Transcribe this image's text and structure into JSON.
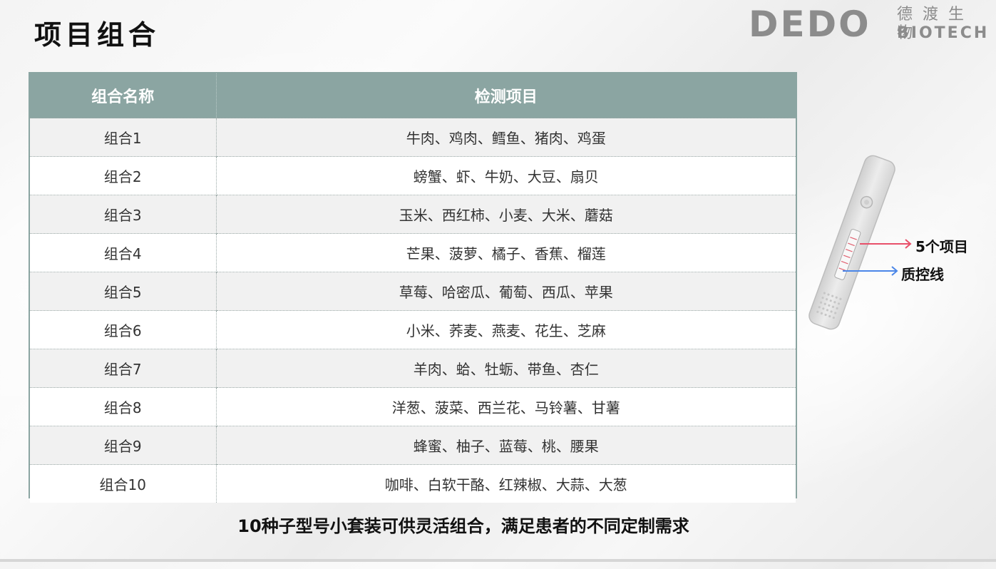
{
  "page": {
    "title": "项目组合"
  },
  "logo": {
    "brand": "DEDO",
    "name_cn": "德渡生物",
    "name_en": "BIOTECH"
  },
  "table": {
    "headers": [
      "组合名称",
      "检测项目"
    ],
    "rows": [
      {
        "name": "组合1",
        "items": "牛肉、鸡肉、鳕鱼、猪肉、鸡蛋"
      },
      {
        "name": "组合2",
        "items": "螃蟹、虾、牛奶、大豆、扇贝"
      },
      {
        "name": "组合3",
        "items": "玉米、西红柿、小麦、大米、蘑菇"
      },
      {
        "name": "组合4",
        "items": "芒果、菠萝、橘子、香蕉、榴莲"
      },
      {
        "name": "组合5",
        "items": "草莓、哈密瓜、葡萄、西瓜、苹果"
      },
      {
        "name": "组合6",
        "items": "小米、荞麦、燕麦、花生、芝麻"
      },
      {
        "name": "组合7",
        "items": "羊肉、蛤、牡蛎、带鱼、杏仁"
      },
      {
        "name": "组合8",
        "items": "洋葱、菠菜、西兰花、马铃薯、甘薯"
      },
      {
        "name": "组合9",
        "items": "蜂蜜、柚子、蓝莓、桃、腰果"
      },
      {
        "name": "组合10",
        "items": "咖啡、白软干酪、红辣椒、大蒜、大葱"
      }
    ]
  },
  "footer": {
    "note": "10种子型号小套装可供灵活组合，满足患者的不同定制需求"
  },
  "diagram": {
    "test_lines_label": "5个项目",
    "control_line_label": "质控线",
    "colors": {
      "test_arrow": "#e8506a",
      "control_arrow": "#4a86e8",
      "header_bg": "#8ba5a2"
    }
  }
}
